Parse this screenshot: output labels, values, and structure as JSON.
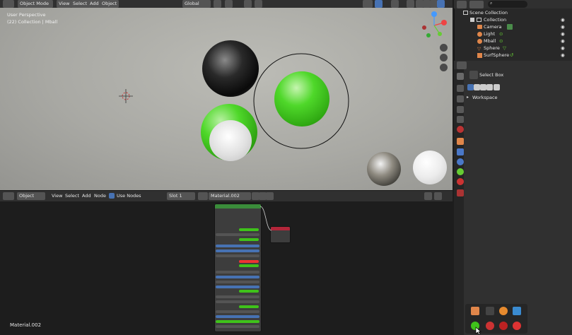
{
  "viewport_header": {
    "mode": "Object Mode",
    "menus": [
      "View",
      "Select",
      "Add",
      "Object"
    ],
    "orientation": "Global"
  },
  "viewport": {
    "view_name": "User Perspective",
    "collection_info": "(22) Collection | Mball"
  },
  "outliner": {
    "search_placeholder": "",
    "root": "Scene Collection",
    "collection": "Collection",
    "items": [
      {
        "name": "Camera",
        "icon": "camera-icon",
        "color": "#e0864a"
      },
      {
        "name": "Light",
        "icon": "light-icon",
        "color": "#e0864a"
      },
      {
        "name": "Mball",
        "icon": "metaball-icon",
        "color": "#e0864a"
      },
      {
        "name": "Sphere",
        "icon": "mesh-icon",
        "color": "#e0864a"
      },
      {
        "name": "SurfSphere",
        "icon": "surface-icon",
        "color": "#e0864a"
      }
    ]
  },
  "properties": {
    "tool_name": "Select Box",
    "workspace_label": "Workspace"
  },
  "node_header": {
    "editor": "Object",
    "menus": [
      "View",
      "Select",
      "Add",
      "Node"
    ],
    "use_nodes_label": "Use Nodes",
    "slot": "Slot 1",
    "material": "Material.002"
  },
  "node_editor": {
    "material_label": "Material.002",
    "bsdf_node_title": "Principled BSDF",
    "output_node_title": "Material Output"
  },
  "colors": {
    "accent": "#4772b3",
    "green_material": "#3fc21a",
    "outliner_bg": "#282828",
    "panel_bg": "#303030"
  }
}
